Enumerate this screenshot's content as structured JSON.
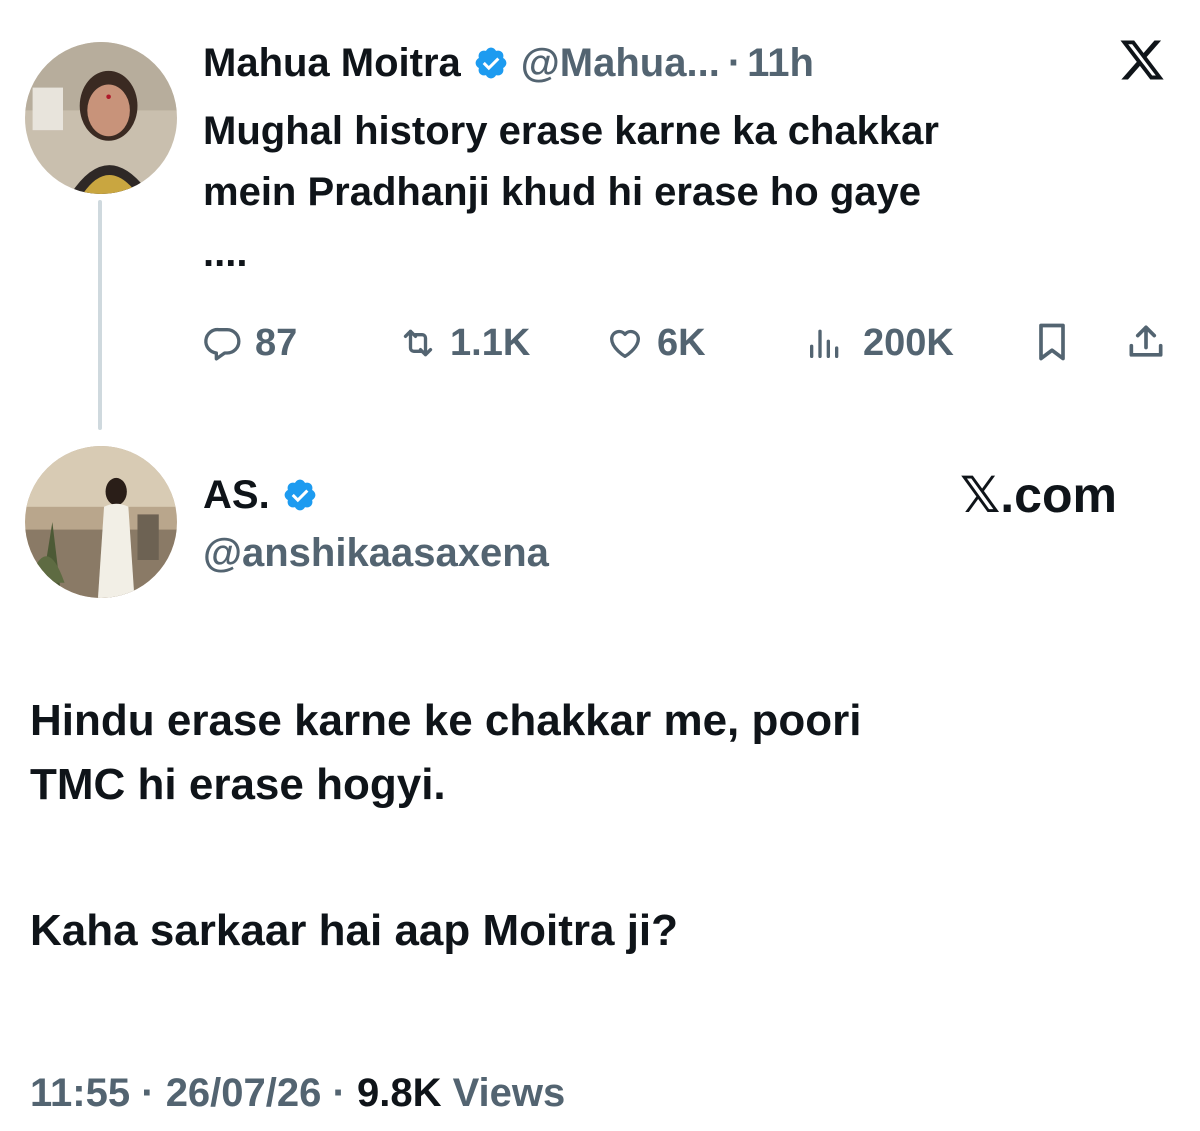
{
  "original_tweet": {
    "author_name": "Mahua Moitra",
    "handle": "@Mahua...",
    "separator": "·",
    "time_ago": "11h",
    "text_lines": [
      "Mughal history erase karne ka chakkar",
      "mein Pradhanji khud hi erase ho gaye",
      "...."
    ],
    "stats": {
      "replies": "87",
      "reposts": "1.1K",
      "likes": "6K",
      "views": "200K"
    }
  },
  "reply_tweet": {
    "author_name": "AS.",
    "handle": "@anshikaasaxena",
    "brand": "𝕏.com",
    "text_lines": [
      "Hindu erase karne ke chakkar me, poori",
      "TMC hi erase hogyi.",
      "",
      "Kaha sarkaar hai aap Moitra ji?"
    ],
    "footer": {
      "time": "11:55",
      "date": "26/07/26",
      "separator": "·",
      "views_count": "9.8K",
      "views_label": "Views"
    }
  },
  "colors": {
    "text": "#0f1419",
    "muted": "#536471",
    "verified": "#1d9bf0",
    "thread_line": "#cfd9de"
  },
  "icons": [
    "x-logo-icon",
    "verified-icon",
    "reply-icon",
    "repost-icon",
    "like-icon",
    "views-icon",
    "bookmark-icon",
    "share-icon"
  ]
}
